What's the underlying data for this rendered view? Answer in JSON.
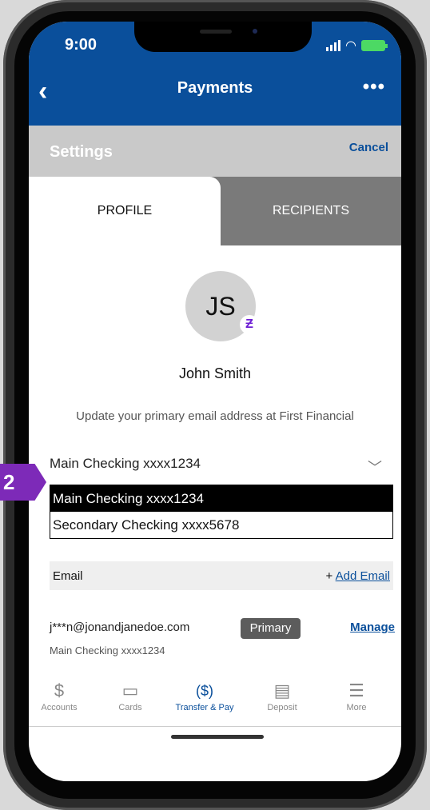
{
  "status_bar": {
    "time": "9:00"
  },
  "header": {
    "title": "Payments",
    "back_icon": "back-chevron-icon",
    "more_icon": "more-icon"
  },
  "settings": {
    "title": "Settings",
    "cancel": "Cancel"
  },
  "tabs": [
    {
      "label": "PROFILE"
    },
    {
      "label": "RECIPIENTS"
    }
  ],
  "profile": {
    "initials": "JS",
    "zelle_symbol": "Ƶ",
    "name": "John Smith",
    "update_text": "Update your primary email address at First Financial"
  },
  "account_select": {
    "current": "Main Checking xxxx1234",
    "options": [
      "Main Checking xxxx1234",
      "Secondary Checking xxxx5678"
    ]
  },
  "email_section": {
    "label": "Email",
    "add_prefix": "+ ",
    "add_link": "Add Email",
    "address": "j***n@jonandjanedoe.com",
    "badge": "Primary",
    "manage": "Manage",
    "account": "Main Checking xxxx1234"
  },
  "bottom_nav": [
    {
      "label": "Accounts",
      "icon": "dollar-icon",
      "glyph": "$"
    },
    {
      "label": "Cards",
      "icon": "card-icon",
      "glyph": "▭"
    },
    {
      "label": "Transfer & Pay",
      "icon": "transfer-pay-icon",
      "glyph": "($)"
    },
    {
      "label": "Deposit",
      "icon": "deposit-check-icon",
      "glyph": "▤"
    },
    {
      "label": "More",
      "icon": "menu-icon",
      "glyph": "☰"
    }
  ],
  "step_badge": "2",
  "colors": {
    "brand_blue": "#0a4f9b",
    "badge_purple": "#7d2ab8",
    "zelle_purple": "#6d1ed4"
  }
}
